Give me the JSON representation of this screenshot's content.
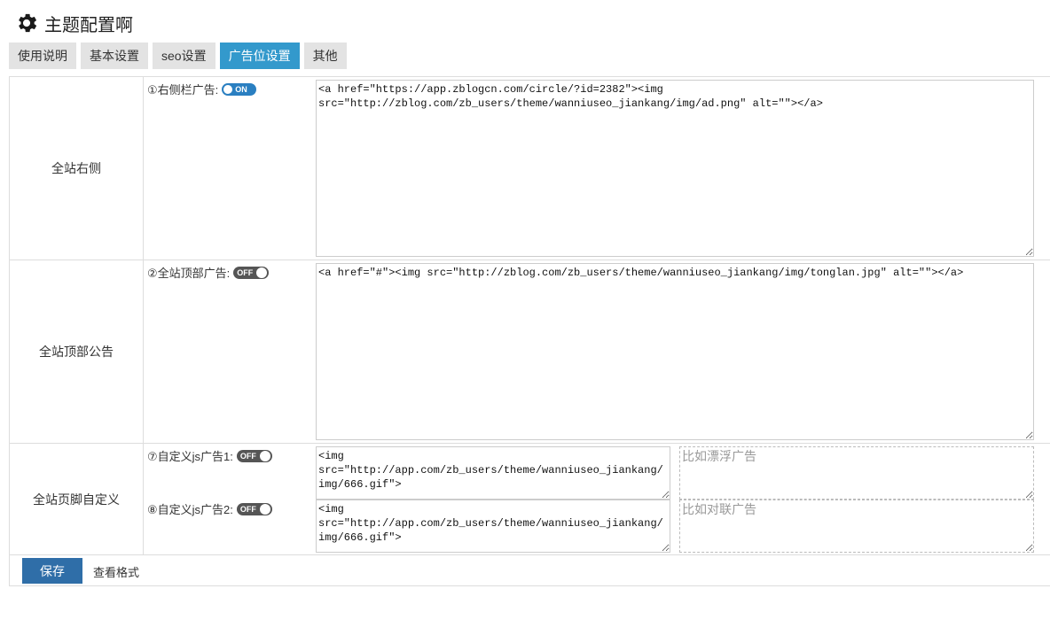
{
  "header": {
    "title": "主题配置啊",
    "icon": "gear-icon"
  },
  "tabs": [
    {
      "label": "使用说明",
      "active": false
    },
    {
      "label": "基本设置",
      "active": false
    },
    {
      "label": "seo设置",
      "active": false
    },
    {
      "label": "广告位设置",
      "active": true
    },
    {
      "label": "其他",
      "active": false
    }
  ],
  "rows": {
    "sidebar": {
      "label": "全站右侧",
      "option_label": "①右侧栏广告:",
      "toggle": "ON",
      "value": "<a href=\"https://app.zblogcn.com/circle/?id=2382\"><img src=\"http://zblog.com/zb_users/theme/wanniuseo_jiankang/img/ad.png\" alt=\"\"></a>"
    },
    "top": {
      "label": "全站顶部公告",
      "option_label": "②全站顶部广告:",
      "toggle": "OFF",
      "value": "<a href=\"#\"><img src=\"http://zblog.com/zb_users/theme/wanniuseo_jiankang/img/tonglan.jpg\" alt=\"\"></a>"
    },
    "footer_custom": {
      "label": "全站页脚自定义",
      "js1": {
        "option_label": "⑦自定义js广告1:",
        "toggle": "OFF",
        "value": "<img src=\"http://app.com/zb_users/theme/wanniuseo_jiankang/img/666.gif\">",
        "note_placeholder": "比如漂浮广告"
      },
      "js2": {
        "option_label": "⑧自定义js广告2:",
        "toggle": "OFF",
        "value": "<img src=\"http://app.com/zb_users/theme/wanniuseo_jiankang/img/666.gif\">",
        "note_placeholder": "比如对联广告"
      }
    }
  },
  "footer": {
    "save_label": "保存",
    "format_link": "查看格式"
  },
  "colors": {
    "accent": "#3399cc",
    "save": "#2f6ea8",
    "toggle_on": "#2a7fc1",
    "toggle_off": "#555555"
  }
}
